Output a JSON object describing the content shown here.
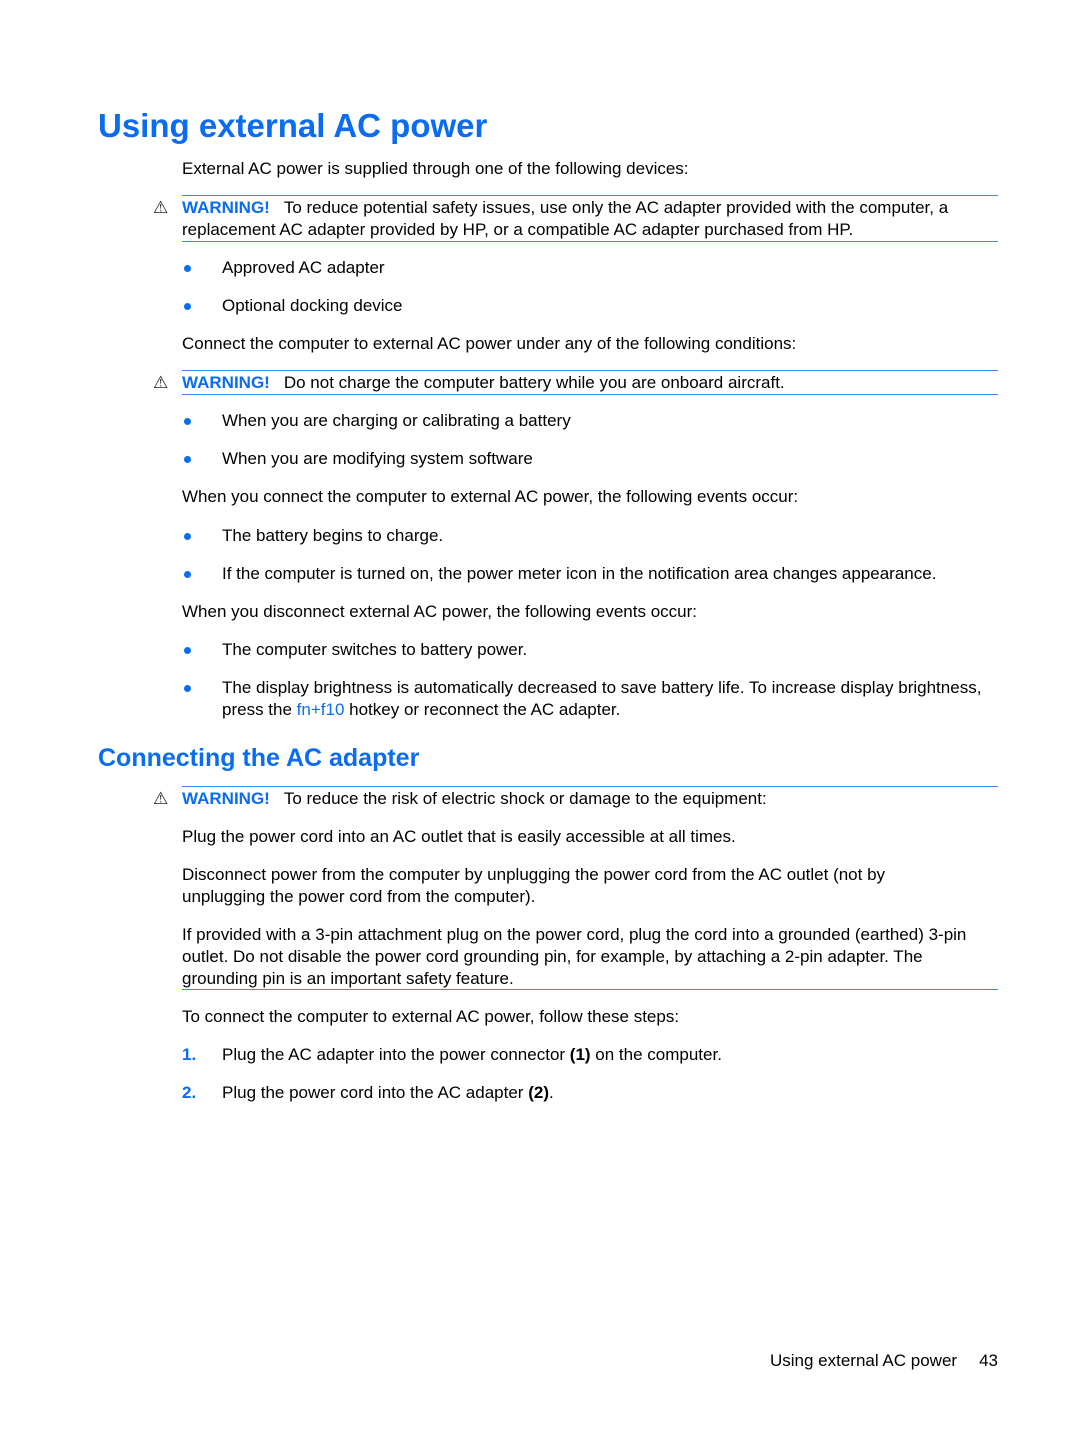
{
  "page": {
    "title": "Using external AC power",
    "intro": "External AC power is supplied through one of the following devices:",
    "warning_label": "WARNING!",
    "warning_1": "To reduce potential safety issues, use only the AC adapter provided with the computer, a replacement AC adapter provided by HP, or a compatible AC adapter purchased from HP.",
    "devices": [
      "Approved AC adapter",
      "Optional docking device"
    ],
    "conditions_intro": "Connect the computer to external AC power under any of the following conditions:",
    "warning_2": "Do not charge the computer battery while you are onboard aircraft.",
    "conditions": [
      "When you are charging or calibrating a battery",
      "When you are modifying system software"
    ],
    "connect_intro": "When you connect the computer to external AC power, the following events occur:",
    "connect_events": [
      "The battery begins to charge.",
      "If the computer is turned on, the power meter icon in the notification area changes appearance."
    ],
    "disconnect_intro": "When you disconnect external AC power, the following events occur:",
    "disconnect_events": {
      "item1": "The computer switches to battery power.",
      "item2_before": "The display brightness is automatically decreased to save battery life. To increase display brightness, press the ",
      "item2_link": "fn+f10",
      "item2_after": " hotkey or reconnect the AC adapter."
    }
  },
  "section": {
    "title": "Connecting the AC adapter",
    "warning_3": "To reduce the risk of electric shock or damage to the equipment:",
    "para_1": "Plug the power cord into an AC outlet that is easily accessible at all times.",
    "para_2": "Disconnect power from the computer by unplugging the power cord from the AC outlet (not by unplugging the power cord from the computer).",
    "para_3": "If provided with a 3-pin attachment plug on the power cord, plug the cord into a grounded (earthed) 3-pin outlet. Do not disable the power cord grounding pin, for example, by attaching a 2-pin adapter. The grounding pin is an important safety feature.",
    "steps_intro": "To connect the computer to external AC power, follow these steps:",
    "steps": [
      {
        "num": "1.",
        "before": "Plug the AC adapter into the power connector ",
        "bold": "(1)",
        "after": " on the computer."
      },
      {
        "num": "2.",
        "before": "Plug the power cord into the AC adapter ",
        "bold": "(2)",
        "after": "."
      }
    ]
  },
  "footer": {
    "section_name": "Using external AC power",
    "page_number": "43"
  },
  "icons": {
    "warning": "⚠"
  },
  "colors": {
    "accent": "#0a6cf0",
    "rule": "#3b8ef0"
  }
}
